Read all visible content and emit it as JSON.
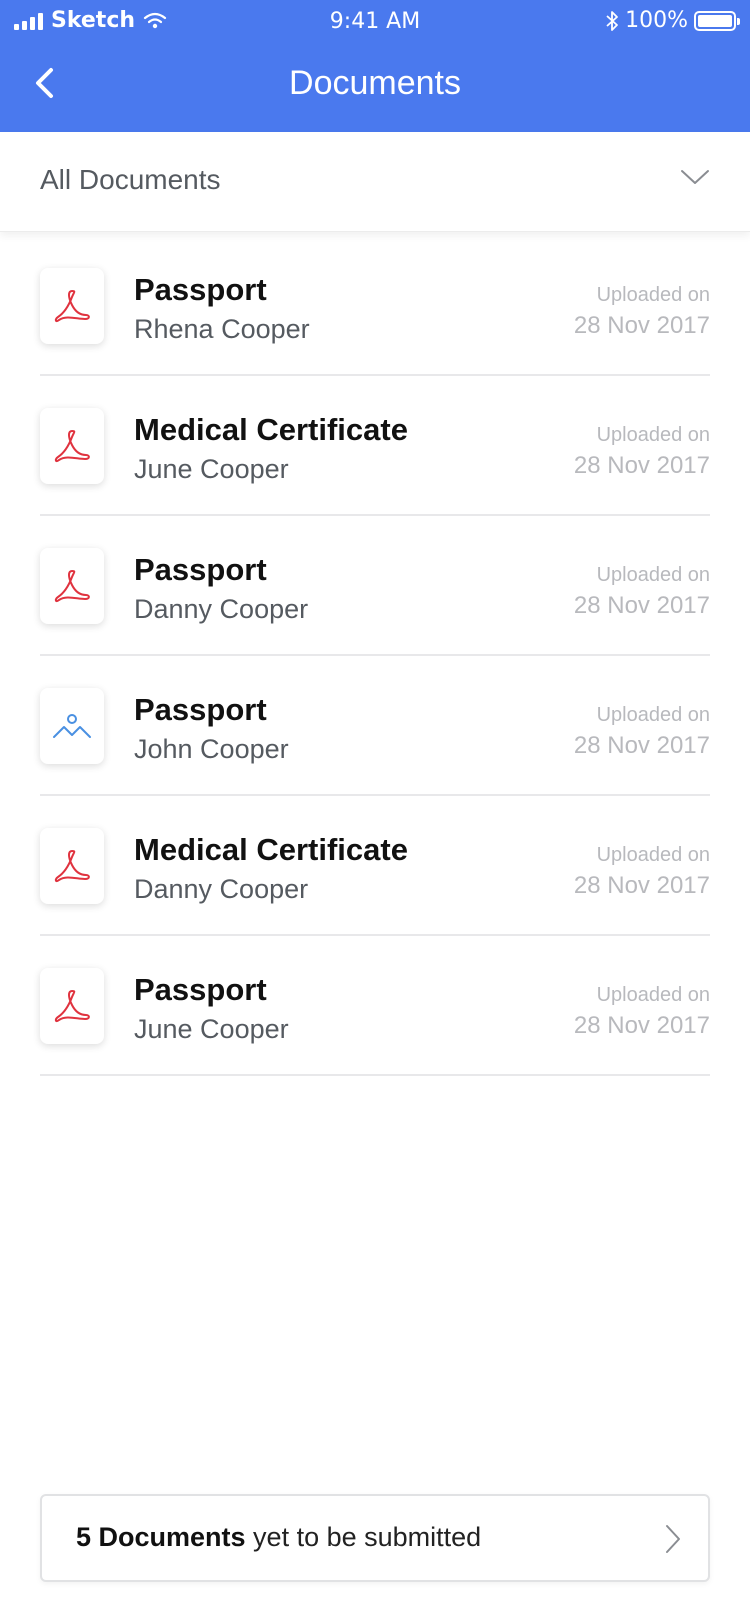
{
  "status_bar": {
    "carrier": "Sketch",
    "time": "9:41 AM",
    "battery": "100%",
    "signal_icon": "signal-bars-icon",
    "wifi_icon": "wifi-icon",
    "bluetooth_icon": "bluetooth-icon",
    "battery_icon": "battery-icon",
    "battery_level": 1.0
  },
  "nav": {
    "title": "Documents",
    "back_icon": "chevron-left-icon"
  },
  "filter": {
    "selected": "All Documents",
    "chevron_icon": "chevron-down-icon"
  },
  "documents": [
    {
      "title": "Passport",
      "owner": "Rhena Cooper",
      "uploaded_label": "Uploaded on",
      "date": "28 Nov 2017",
      "icon": "pdf-icon"
    },
    {
      "title": "Medical Certificate",
      "owner": "June Cooper",
      "uploaded_label": "Uploaded on",
      "date": "28 Nov 2017",
      "icon": "pdf-icon"
    },
    {
      "title": "Passport",
      "owner": "Danny Cooper",
      "uploaded_label": "Uploaded on",
      "date": "28 Nov 2017",
      "icon": "pdf-icon"
    },
    {
      "title": "Passport",
      "owner": "John Cooper",
      "uploaded_label": "Uploaded on",
      "date": "28 Nov 2017",
      "icon": "image-icon"
    },
    {
      "title": "Medical Certificate",
      "owner": "Danny Cooper",
      "uploaded_label": "Uploaded on",
      "date": "28 Nov 2017",
      "icon": "pdf-icon"
    },
    {
      "title": "Passport",
      "owner": "June Cooper",
      "uploaded_label": "Uploaded on",
      "date": "28 Nov 2017",
      "icon": "pdf-icon"
    }
  ],
  "pending": {
    "count_label": "5 Documents",
    "suffix": " yet to be submitted",
    "chevron_icon": "chevron-right-icon"
  },
  "colors": {
    "header": "#4a79ee",
    "pdf_icon": "#e0333f",
    "image_icon": "#4a90e2",
    "muted_text": "#b8b9bd"
  }
}
